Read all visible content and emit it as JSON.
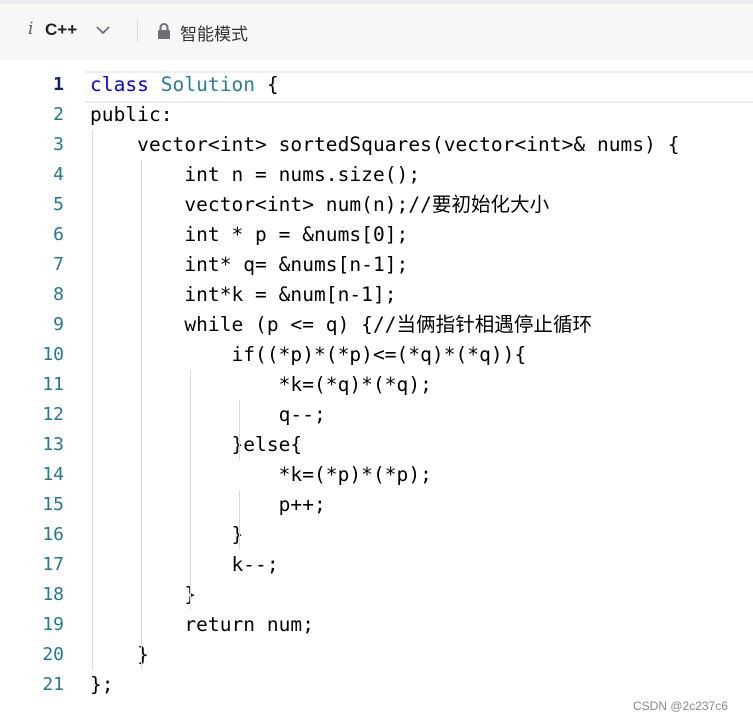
{
  "toolbar": {
    "language_icon": "i",
    "language": "C++",
    "language_dropdown_icon": "chevron-down-icon",
    "mode_icon": "lock-icon",
    "mode_label": "智能模式"
  },
  "editor": {
    "line_numbers": [
      "1",
      "2",
      "3",
      "4",
      "5",
      "6",
      "7",
      "8",
      "9",
      "10",
      "11",
      "12",
      "13",
      "14",
      "15",
      "16",
      "17",
      "18",
      "19",
      "20",
      "21"
    ],
    "lines": [
      "class Solution {",
      "public:",
      "    vector<int> sortedSquares(vector<int>& nums) {",
      "        int n = nums.size();",
      "        vector<int> num(n);//要初始化大小",
      "        int * p = &nums[0];",
      "        int* q= &nums[n-1];",
      "        int*k = &num[n-1];",
      "        while (p <= q) {//当俩指针相遇停止循环",
      "            if((*p)*(*p)<=(*q)*(*q)){",
      "                *k=(*q)*(*q);",
      "                q--;",
      "            }else{",
      "                *k=(*p)*(*p);",
      "                p++;",
      "            }",
      "            k--;",
      "        }",
      "        return num;",
      "    }",
      "};"
    ]
  },
  "watermark": "CSDN @2c237c6"
}
